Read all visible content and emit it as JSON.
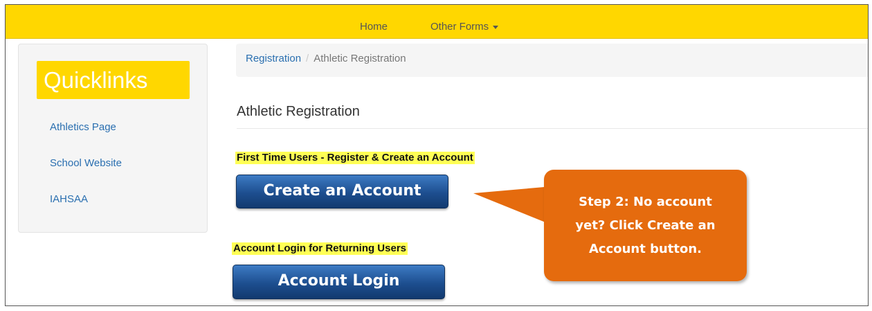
{
  "navbar": {
    "home_label": "Home",
    "other_forms_label": "Other Forms"
  },
  "sidebar": {
    "title": "Quicklinks",
    "items": [
      {
        "label": "Athletics Page"
      },
      {
        "label": "School Website"
      },
      {
        "label": "IAHSAA"
      }
    ]
  },
  "breadcrumb": {
    "parent": "Registration",
    "separator": "/",
    "current": "Athletic Registration"
  },
  "main": {
    "title": "Athletic Registration",
    "new_users_label": "First Time Users - Register & Create an Account",
    "create_button": "Create an Account",
    "returning_label": "Account Login for Returning Users",
    "login_button": "Account Login"
  },
  "callout": {
    "text": "Step 2: No account yet? Click Create an Account button."
  },
  "colors": {
    "navbar": "#ffd700",
    "link": "#2a6fb0",
    "button": "#1d4e8f",
    "callout": "#e56b0e",
    "highlight": "#ffff55"
  }
}
